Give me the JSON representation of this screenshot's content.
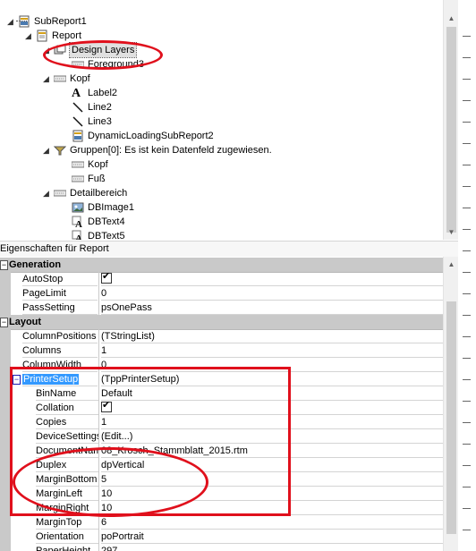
{
  "tree": {
    "nodes": [
      {
        "label": "SubReport1",
        "level": 0,
        "expander": "◢",
        "icon": "subreport-icon"
      },
      {
        "label": "Report",
        "level": 1,
        "expander": "◢",
        "icon": "report-icon"
      },
      {
        "label": "Design Layers",
        "level": 2,
        "expander": "◢",
        "icon": "layers-icon",
        "selected": true
      },
      {
        "label": "Foreground3",
        "level": 3,
        "expander": "",
        "icon": "band-icon"
      },
      {
        "label": "Kopf",
        "level": 2,
        "expander": "◢",
        "icon": "band-icon"
      },
      {
        "label": "Label2",
        "level": 3,
        "expander": "",
        "icon": "label-icon"
      },
      {
        "label": "Line2",
        "level": 3,
        "expander": "",
        "icon": "line-icon"
      },
      {
        "label": "Line3",
        "level": 3,
        "expander": "",
        "icon": "line-icon"
      },
      {
        "label": "DynamicLoadingSubReport2",
        "level": 3,
        "expander": "",
        "icon": "subreport-icon"
      },
      {
        "label": "Gruppen[0]: Es ist kein Datenfeld zugewiesen.",
        "level": 2,
        "expander": "◢",
        "icon": "group-icon"
      },
      {
        "label": "Kopf",
        "level": 3,
        "expander": "",
        "icon": "band-icon"
      },
      {
        "label": "Fuß",
        "level": 3,
        "expander": "",
        "icon": "band-icon"
      },
      {
        "label": "Detailbereich",
        "level": 2,
        "expander": "◢",
        "icon": "band-icon"
      },
      {
        "label": "DBImage1",
        "level": 3,
        "expander": "",
        "icon": "dbimage-icon"
      },
      {
        "label": "DBText4",
        "level": 3,
        "expander": "",
        "icon": "dbtext-icon"
      },
      {
        "label": "DBText5",
        "level": 3,
        "expander": "",
        "icon": "dbtext-icon"
      }
    ]
  },
  "header": {
    "title": "Eigenschaften für Report"
  },
  "properties": {
    "categories": [
      {
        "name": "Generation",
        "rows": [
          {
            "name": "AutoStop",
            "value": "",
            "checkbox": true
          },
          {
            "name": "PageLimit",
            "value": "0"
          },
          {
            "name": "PassSetting",
            "value": "psOnePass"
          }
        ]
      },
      {
        "name": "Layout",
        "rows": [
          {
            "name": "ColumnPositions",
            "value": "(TStringList)"
          },
          {
            "name": "Columns",
            "value": "1"
          },
          {
            "name": "ColumnWidth",
            "value": "0"
          },
          {
            "name": "PrinterSetup",
            "value": "(TppPrinterSetup)",
            "expandable": true,
            "selected": true
          },
          {
            "name": "BinName",
            "value": "Default",
            "sub": true
          },
          {
            "name": "Collation",
            "value": "",
            "checkbox": true,
            "sub": true
          },
          {
            "name": "Copies",
            "value": "1",
            "sub": true
          },
          {
            "name": "DeviceSettings",
            "value": "(Edit...)",
            "sub": true
          },
          {
            "name": "DocumentName",
            "value": "08_Krosch_Stammblatt_2015.rtm",
            "sub": true
          },
          {
            "name": "Duplex",
            "value": "dpVertical",
            "sub": true
          },
          {
            "name": "MarginBottom",
            "value": "5",
            "sub": true
          },
          {
            "name": "MarginLeft",
            "value": "10",
            "sub": true
          },
          {
            "name": "MarginRight",
            "value": "10",
            "sub": true
          },
          {
            "name": "MarginTop",
            "value": "6",
            "sub": true
          },
          {
            "name": "Orientation",
            "value": "poPortrait",
            "sub": true
          },
          {
            "name": "PaperHeight",
            "value": "297",
            "sub": true
          }
        ]
      }
    ]
  },
  "colors": {
    "annotation": "#e0101c",
    "category_bg": "#c9c9c9",
    "selection": "#3399ff"
  }
}
